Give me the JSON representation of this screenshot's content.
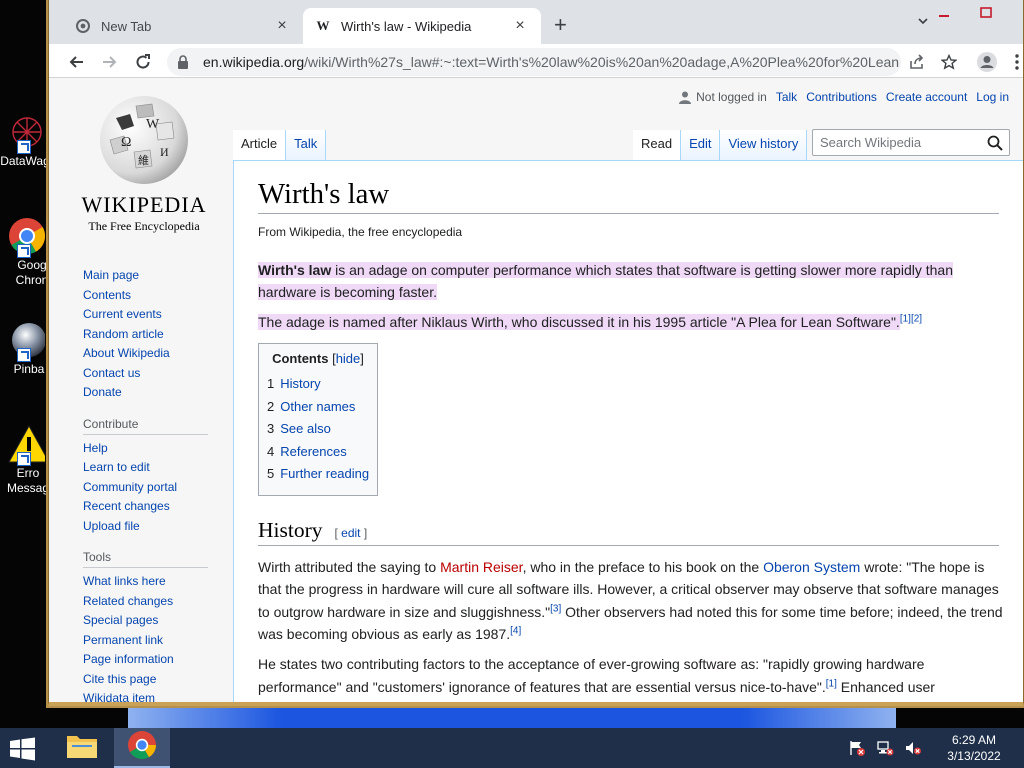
{
  "desktop": {
    "icons": [
      {
        "label": "DataWag",
        "name": "datawag"
      },
      {
        "label": "Goog Chron",
        "name": "google-chrome"
      },
      {
        "label": "Pinba",
        "name": "pinball"
      },
      {
        "label": "Erro Messag",
        "name": "error-message"
      }
    ]
  },
  "browser": {
    "tabs": [
      {
        "title": "New Tab",
        "state": "inactive"
      },
      {
        "title": "Wirth's law - Wikipedia",
        "state": "active"
      }
    ],
    "url_host": "en.wikipedia.org",
    "url_rest": "/wiki/Wirth%27s_law#:~:text=Wirth's%20law%20is%20an%20adage,A%20Plea%20for%20Lean..."
  },
  "wiki": {
    "logo_wordmark": "WIKIPEDIA",
    "logo_tagline": "The Free Encyclopedia",
    "personal": {
      "not_logged_in": "Not logged in",
      "talk": "Talk",
      "contributions": "Contributions",
      "create_account": "Create account",
      "log_in": "Log in"
    },
    "tabs_left": [
      "Article",
      "Talk"
    ],
    "tabs_right": [
      "Read",
      "Edit",
      "View history"
    ],
    "search_placeholder": "Search Wikipedia",
    "sidebar": {
      "main": [
        "Main page",
        "Contents",
        "Current events",
        "Random article",
        "About Wikipedia",
        "Contact us",
        "Donate"
      ],
      "contribute_heading": "Contribute",
      "contribute": [
        "Help",
        "Learn to edit",
        "Community portal",
        "Recent changes",
        "Upload file"
      ],
      "tools_heading": "Tools",
      "tools": [
        "What links here",
        "Related changes",
        "Special pages",
        "Permanent link",
        "Page information",
        "Cite this page",
        "Wikidata item"
      ]
    },
    "article": {
      "title": "Wirth's law",
      "site_sub": "From Wikipedia, the free encyclopedia",
      "lead_bold": "Wirth's law",
      "lead_rest": " is an adage on computer performance which states that software is getting slower more rapidly than hardware is becoming faster.",
      "second": "The adage is named after Niklaus Wirth, who discussed it in his 1995 article \"A Plea for Lean Software\".",
      "second_refs": [
        "[1]",
        "[2]"
      ],
      "toc_title": "Contents",
      "toc_hide": "hide",
      "toc": [
        {
          "num": "1",
          "text": "History"
        },
        {
          "num": "2",
          "text": "Other names"
        },
        {
          "num": "3",
          "text": "See also"
        },
        {
          "num": "4",
          "text": "References"
        },
        {
          "num": "5",
          "text": "Further reading"
        }
      ],
      "history_heading": "History",
      "edit_link": "edit",
      "h_p1_a": "Wirth attributed the saying to ",
      "h_p1_link1": "Martin Reiser",
      "h_p1_b": ", who in the preface to his book on the ",
      "h_p1_link2": "Oberon System",
      "h_p1_c": " wrote: \"The hope is that the progress in hardware will cure all software ills. However, a critical observer may observe that software manages to outgrow hardware in size and sluggishness.\"",
      "h_p1_ref1": "[3]",
      "h_p1_d": " Other observers had noted this for some time before; indeed, the trend was becoming obvious as early as 1987.",
      "h_p1_ref2": "[4]",
      "h_p2_a": "He states two contributing factors to the acceptance of ever-growing software as: \"rapidly growing hardware performance\" and \"customers' ignorance of features that are essential versus nice-to-have\".",
      "h_p2_ref": "[1]",
      "h_p2_b": " Enhanced user"
    }
  },
  "taskbar": {
    "time": "6:29 AM",
    "date": "3/13/2022"
  }
}
